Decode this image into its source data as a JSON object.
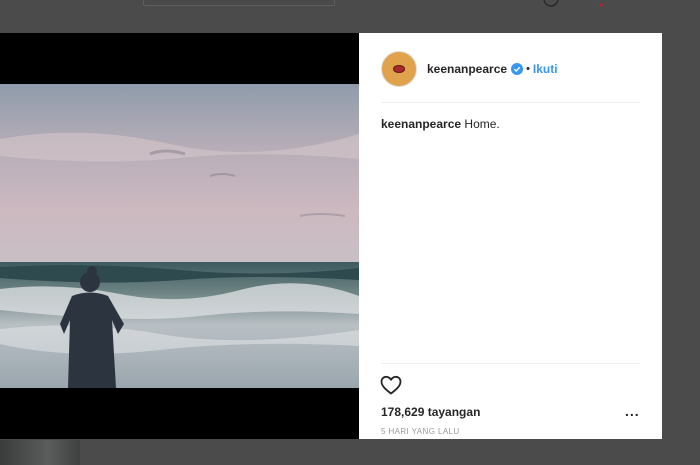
{
  "post": {
    "username": "keenanpearce",
    "verified": true,
    "separator": "•",
    "follow_label": "Ikuti",
    "caption_user": "keenanpearce",
    "caption_text": "Home.",
    "views": "178,629 tayangan",
    "more_label": "...",
    "time_ago": "5 HARI YANG LALU"
  },
  "colors": {
    "link": "#3897f0",
    "verified_badge": "#3897f0",
    "text": "#262626",
    "muted": "#999999"
  }
}
